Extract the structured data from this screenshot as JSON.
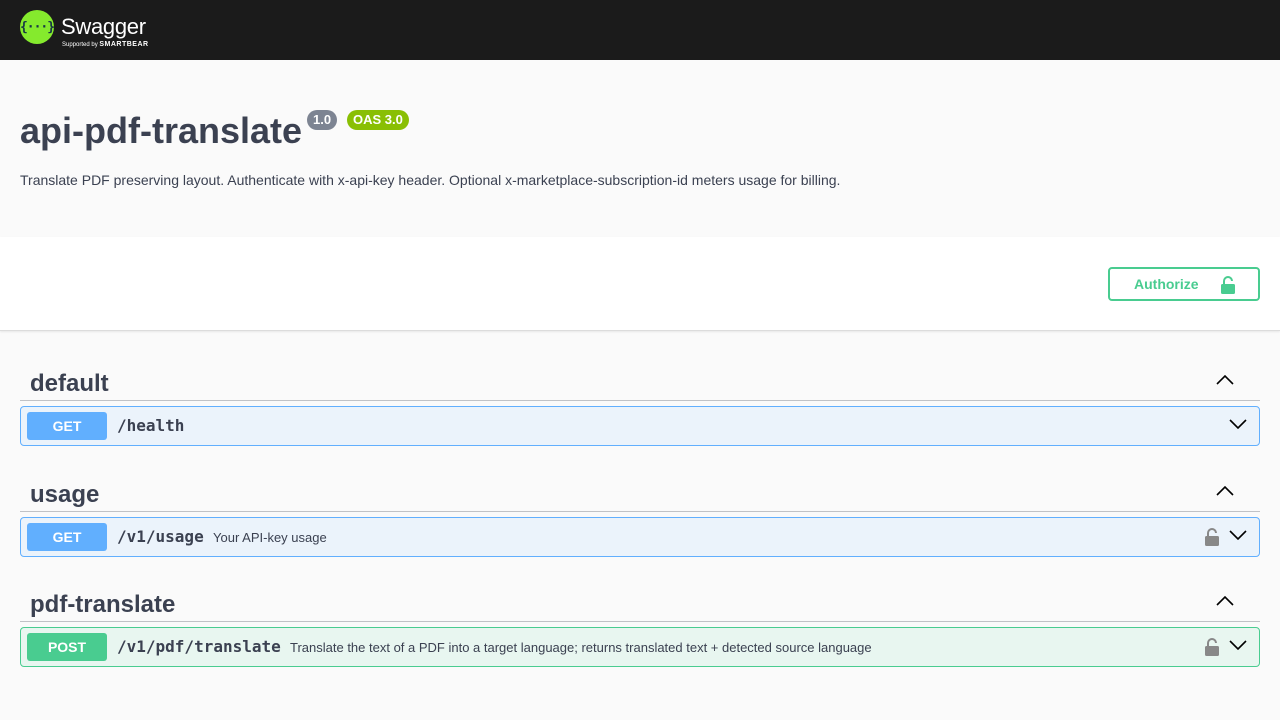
{
  "topbar": {
    "logo_mark": "{···}",
    "logo_title": "Swagger",
    "logo_sub_prefix": "Supported by ",
    "logo_sub_brand": "SMARTBEAR"
  },
  "info": {
    "title": "api-pdf-translate",
    "version_badge": "1.0",
    "oas_badge": "OAS 3.0",
    "description": "Translate PDF preserving layout. Authenticate with x-api-key header. Optional x-marketplace-subscription-id meters usage for billing."
  },
  "authorize": {
    "label": "Authorize",
    "icon": "unlocked-icon",
    "color": "#49cc90"
  },
  "tags": [
    {
      "name": "default"
    },
    {
      "name": "usage"
    },
    {
      "name": "pdf-translate"
    }
  ],
  "operations": [
    {
      "method": "GET",
      "path": "/health",
      "summary": "",
      "locked": false
    },
    {
      "method": "GET",
      "path": "/v1/usage",
      "summary": "Your API-key usage",
      "locked": true
    },
    {
      "method": "POST",
      "path": "/v1/pdf/translate",
      "summary": "Translate the text of a PDF into a target language; returns translated text + detected source language",
      "locked": true
    }
  ],
  "colors": {
    "get": "#61affe",
    "post": "#49cc90",
    "topbar": "#1b1b1b",
    "logo": "#85ea2d"
  }
}
